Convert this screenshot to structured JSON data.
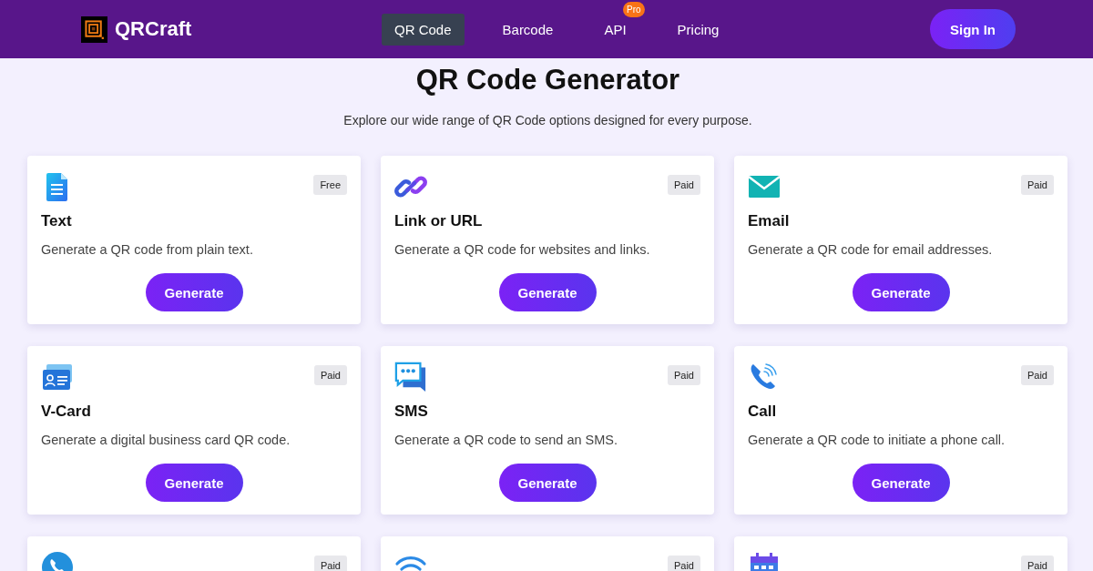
{
  "header": {
    "brand": "QRCraft",
    "nav": [
      {
        "label": "QR Code",
        "selected": true
      },
      {
        "label": "Barcode",
        "selected": false
      },
      {
        "label": "API",
        "selected": false,
        "badge": "Pro"
      },
      {
        "label": "Pricing",
        "selected": false
      }
    ],
    "sign_in": "Sign In"
  },
  "title": "QR Code Generator",
  "subtitle": "Explore our wide range of QR Code options designed for every purpose.",
  "cards": [
    {
      "kind": "document",
      "tier": "Free",
      "title": "Text",
      "description": "Generate a QR code from plain text.",
      "button": "Generate"
    },
    {
      "kind": "link",
      "tier": "Paid",
      "title": "Link or URL",
      "description": "Generate a QR code for websites and links.",
      "button": "Generate"
    },
    {
      "kind": "envelope",
      "tier": "Paid",
      "title": "Email",
      "description": "Generate a QR code for email addresses.",
      "button": "Generate"
    },
    {
      "kind": "vcard",
      "tier": "Paid",
      "title": "V-Card",
      "description": "Generate a digital business card QR code.",
      "button": "Generate"
    },
    {
      "kind": "chat",
      "tier": "Paid",
      "title": "SMS",
      "description": "Generate a QR code to send an SMS.",
      "button": "Generate"
    },
    {
      "kind": "phone",
      "tier": "Paid",
      "title": "Call",
      "description": "Generate a QR code to initiate a phone call.",
      "button": "Generate"
    },
    {
      "kind": "phone-circle",
      "tier": "Paid"
    },
    {
      "kind": "wifi",
      "tier": "Paid"
    },
    {
      "kind": "calendar",
      "tier": "Paid"
    }
  ]
}
